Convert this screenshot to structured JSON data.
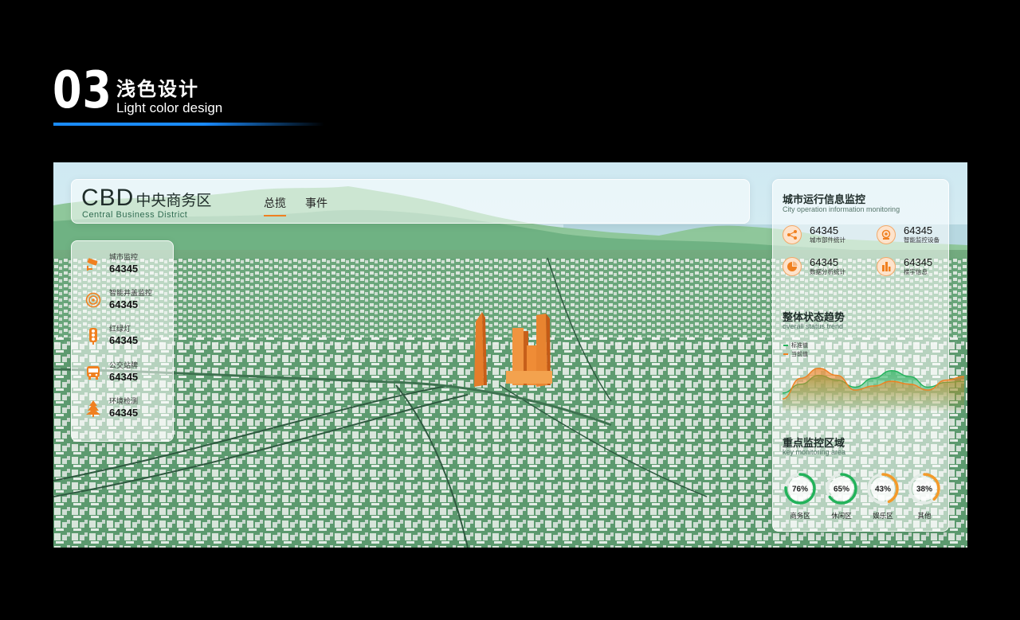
{
  "header": {
    "number": "03",
    "title_cn": "浅色设计",
    "title_en": "Light color design"
  },
  "topbar": {
    "title_big": "CBD",
    "title_cn": "中央商务区",
    "subtitle": "Central Business District",
    "tabs": [
      {
        "label": "总揽",
        "active": true
      },
      {
        "label": "事件",
        "active": false
      }
    ]
  },
  "left_panel": {
    "items": [
      {
        "icon": "camera-icon",
        "label": "城市监控",
        "value": "64345"
      },
      {
        "icon": "well-monitor-icon",
        "label": "智能井盖监控",
        "value": "64345"
      },
      {
        "icon": "traffic-light-icon",
        "label": "红绿灯",
        "value": "64345"
      },
      {
        "icon": "bus-icon",
        "label": "公交站牌",
        "value": "64345"
      },
      {
        "icon": "tree-icon",
        "label": "环境检测",
        "value": "64345"
      }
    ]
  },
  "right_panel": {
    "section1": {
      "title": "城市运行信息监控",
      "subtitle": "City operation information monitoring",
      "stats": [
        {
          "icon": "share-icon",
          "value": "64345",
          "label": "城市部件统计"
        },
        {
          "icon": "monitor-device-icon",
          "value": "64345",
          "label": "智能监控设备"
        },
        {
          "icon": "pie-chart-icon",
          "value": "64345",
          "label": "数据分析统计"
        },
        {
          "icon": "building-icon",
          "value": "64345",
          "label": "楼宇信息"
        }
      ]
    },
    "section2": {
      "title": "整体状态趋势",
      "subtitle": "overall status trend"
    },
    "section3": {
      "title": "重点监控区域",
      "subtitle": "key monitoring area"
    }
  },
  "colors": {
    "accent": "#f08020",
    "green": "#22b25a",
    "orange": "#f39a2a",
    "blue_line": "#1a8cff"
  },
  "chart_data": [
    {
      "type": "area",
      "title": "整体状态趋势",
      "legend": "top-left",
      "grid": false,
      "x": [
        0,
        1,
        2,
        3,
        4,
        5,
        6,
        7,
        8,
        9,
        10
      ],
      "series": [
        {
          "name": "标准值",
          "color": "#22b25a",
          "values": [
            30,
            45,
            60,
            52,
            40,
            55,
            68,
            58,
            40,
            48,
            50
          ]
        },
        {
          "name": "当前值",
          "color": "#f08020",
          "values": [
            20,
            55,
            72,
            60,
            35,
            42,
            50,
            45,
            35,
            52,
            58
          ]
        }
      ],
      "ylim": [
        0,
        100
      ]
    },
    {
      "type": "pie",
      "title": "重点监控区域",
      "slices": [
        {
          "label": "商务区",
          "value": 76,
          "display": "76%",
          "color": "#22b25a"
        },
        {
          "label": "休闲区",
          "value": 65,
          "display": "65%",
          "color": "#22b25a"
        },
        {
          "label": "娱乐区",
          "value": 43,
          "display": "43%",
          "color": "#f39a2a"
        },
        {
          "label": "其他",
          "value": 38,
          "display": "38%",
          "color": "#f39a2a"
        }
      ]
    }
  ]
}
